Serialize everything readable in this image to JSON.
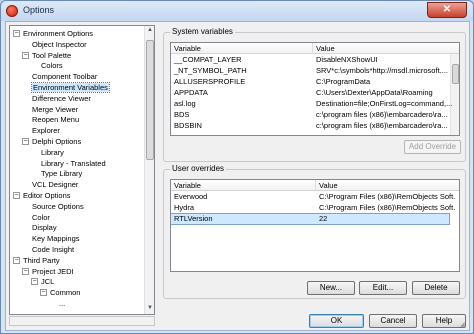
{
  "window": {
    "title": "Options",
    "close_glyph": "✕"
  },
  "tree": {
    "items": [
      {
        "label": "Environment Options",
        "level": 0,
        "expander": "−"
      },
      {
        "label": "Object Inspector",
        "level": 1,
        "expander": ""
      },
      {
        "label": "Tool Palette",
        "level": 1,
        "expander": "−"
      },
      {
        "label": "Colors",
        "level": 2,
        "expander": ""
      },
      {
        "label": "Component Toolbar",
        "level": 1,
        "expander": ""
      },
      {
        "label": "Environment Variables",
        "level": 1,
        "expander": "",
        "selected": true
      },
      {
        "label": "Difference Viewer",
        "level": 1,
        "expander": ""
      },
      {
        "label": "Merge Viewer",
        "level": 1,
        "expander": ""
      },
      {
        "label": "Reopen Menu",
        "level": 1,
        "expander": ""
      },
      {
        "label": "Explorer",
        "level": 1,
        "expander": ""
      },
      {
        "label": "Delphi Options",
        "level": 1,
        "expander": "−"
      },
      {
        "label": "Library",
        "level": 2,
        "expander": ""
      },
      {
        "label": "Library - Translated",
        "level": 2,
        "expander": ""
      },
      {
        "label": "Type Library",
        "level": 2,
        "expander": ""
      },
      {
        "label": "VCL Designer",
        "level": 1,
        "expander": ""
      },
      {
        "label": "Editor Options",
        "level": 0,
        "expander": "−"
      },
      {
        "label": "Source Options",
        "level": 1,
        "expander": ""
      },
      {
        "label": "Color",
        "level": 1,
        "expander": ""
      },
      {
        "label": "Display",
        "level": 1,
        "expander": ""
      },
      {
        "label": "Key Mappings",
        "level": 1,
        "expander": ""
      },
      {
        "label": "Code Insight",
        "level": 1,
        "expander": ""
      },
      {
        "label": "Third Party",
        "level": 0,
        "expander": "−"
      },
      {
        "label": "Project JEDI",
        "level": 1,
        "expander": "−"
      },
      {
        "label": "JCL",
        "level": 2,
        "expander": "−"
      },
      {
        "label": "Common",
        "level": 3,
        "expander": "−"
      },
      {
        "label": "...",
        "level": 4,
        "expander": ""
      }
    ]
  },
  "system_variables": {
    "group_label": "System variables",
    "columns": [
      "Variable",
      "Value"
    ],
    "rows": [
      [
        "__COMPAT_LAYER",
        "DisableNXShowUI"
      ],
      [
        "_NT_SYMBOL_PATH",
        "SRV*c:\\symbols*http://msdl.microsoft...."
      ],
      [
        "ALLUSERSPROFILE",
        "C:\\ProgramData"
      ],
      [
        "APPDATA",
        "C:\\Users\\Dexter\\AppData\\Roaming"
      ],
      [
        "asl.log",
        "Destination=file;OnFirstLog=command,..."
      ],
      [
        "BDS",
        "c:\\program files (x86)\\embarcadero\\ra..."
      ],
      [
        "BDSBIN",
        "c:\\program files (x86)\\embarcadero\\ra..."
      ]
    ],
    "add_override_label": "Add Override"
  },
  "user_overrides": {
    "group_label": "User overrides",
    "columns": [
      "Variable",
      "Value"
    ],
    "rows": [
      [
        "Everwood",
        "C:\\Program Files (x86)\\RemObjects Soft..."
      ],
      [
        "Hydra",
        "C:\\Program Files (x86)\\RemObjects Soft..."
      ],
      [
        "RTLVersion",
        "22"
      ]
    ],
    "selected_row": 2,
    "new_label": "New...",
    "edit_label": "Edit...",
    "delete_label": "Delete"
  },
  "footer": {
    "ok_label": "OK",
    "cancel_label": "Cancel",
    "help_label": "Help"
  }
}
